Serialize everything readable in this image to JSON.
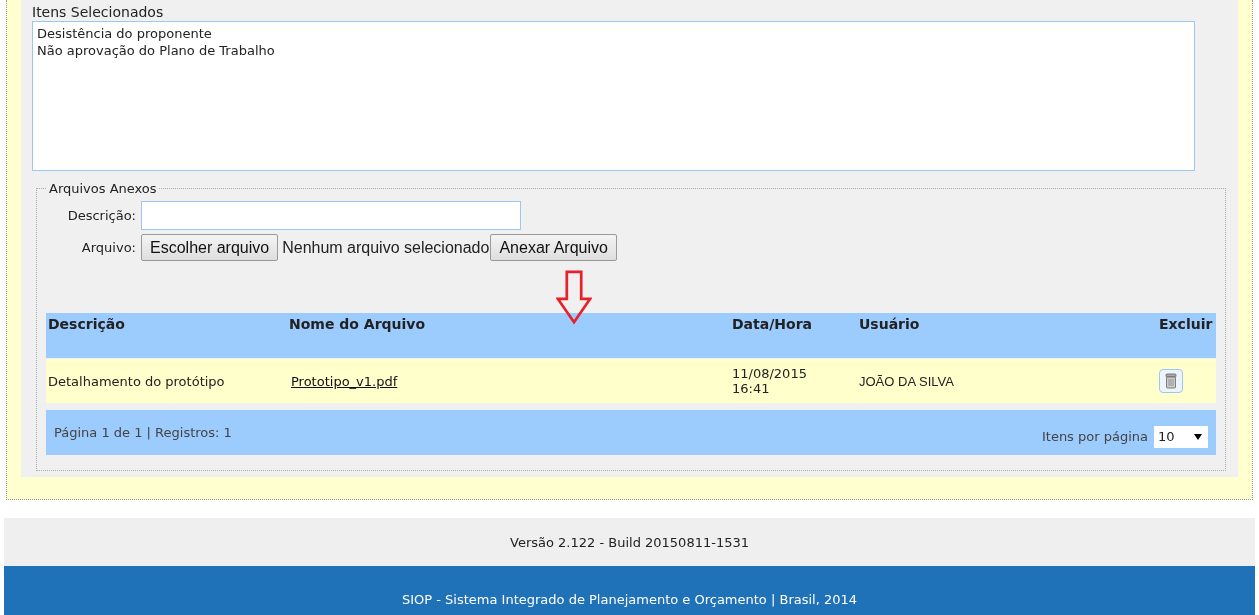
{
  "selected_items": {
    "label": "Itens Selecionados",
    "items": [
      "Desistência do proponente",
      "Não aprovação do Plano de Trabalho"
    ]
  },
  "attachments": {
    "legend": "Arquivos Anexos",
    "description_label": "Descrição:",
    "file_label": "Arquivo:",
    "choose_button": "Escolher arquivo",
    "no_file_text": "Nenhum arquivo selecionado",
    "attach_button": "Anexar Arquivo",
    "table": {
      "columns": [
        "Descrição",
        "Nome do Arquivo",
        "Data/Hora",
        "Usuário",
        "Excluir"
      ],
      "rows": [
        {
          "description": "Detalhamento do protótipo",
          "file_name": "Prototipo_v1.pdf",
          "date_time": [
            "11/08/2015",
            "16:41"
          ],
          "user": "JOÃO DA SILVA"
        }
      ]
    },
    "pager": {
      "summary": "Página 1 de 1 | Registros: 1",
      "per_page_label": "Itens por página",
      "per_page_value": "10"
    }
  },
  "footer": {
    "version": "Versão 2.122 - Build 20150811-1531",
    "credits": "SIOP - Sistema Integrado de Planejamento e Orçamento | Brasil, 2014"
  }
}
